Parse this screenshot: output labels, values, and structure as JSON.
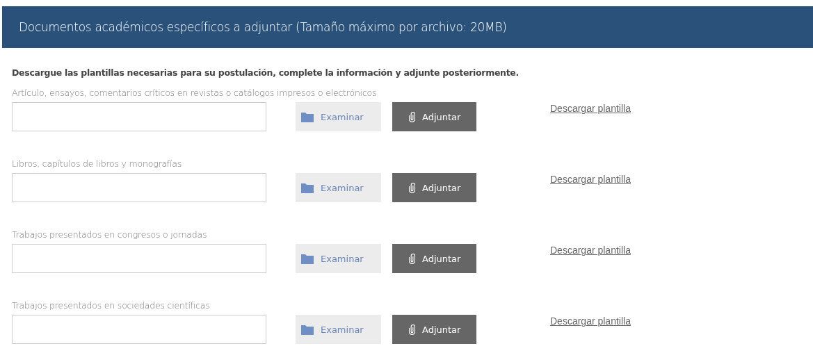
{
  "header": {
    "title": "Documentos académicos específicos a adjuntar (Tamaño máximo por archivo: 20MB)"
  },
  "instructions": "Descargue las plantillas necesarias para su postulación, complete la información y adjunte posteriormente.",
  "documents": [
    {
      "label": "Artículo, ensayos, comentarios críticos en revistas o catálogos impresos o electrónicos",
      "browse": "Examinar",
      "attach": "Adjuntar",
      "link": "Descargar plantilla"
    },
    {
      "label": "Libros, capítulos de libros y monografías",
      "browse": "Examinar",
      "attach": "Adjuntar",
      "link": "Descargar plantilla"
    },
    {
      "label": "Trabajos presentados en congresos o jornadas",
      "browse": "Examinar",
      "attach": "Adjuntar",
      "link": "Descargar plantilla"
    },
    {
      "label": "Trabajos presentados en sociedades científicas",
      "browse": "Examinar",
      "attach": "Adjuntar",
      "link": "Descargar plantilla"
    }
  ]
}
